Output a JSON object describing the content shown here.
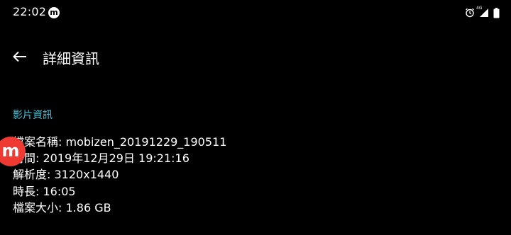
{
  "status_bar": {
    "time": "22:02",
    "app_icon_glyph": "m",
    "network_label": "4G",
    "icons": [
      "alarm-icon",
      "signal-icon",
      "battery-icon"
    ]
  },
  "app_bar": {
    "title": "詳細資訊",
    "back_icon": "arrow-left-icon"
  },
  "section": {
    "title": "影片資訊"
  },
  "details": [
    {
      "label": "檔案名稱:",
      "value": "mobizen_20191229_190511"
    },
    {
      "label": "時間:",
      "value": "2019年12月29日 19:21:16"
    },
    {
      "label": "解析度:",
      "value": "3120x1440"
    },
    {
      "label": "時長:",
      "value": "16:05"
    },
    {
      "label": "檔案大小:",
      "value": "1.86 GB"
    }
  ],
  "overlay": {
    "glyph": "m"
  },
  "colors": {
    "background": "#000000",
    "text": "#ffffff",
    "accent": "#40c4d9",
    "overlay": "#ef3a33"
  }
}
